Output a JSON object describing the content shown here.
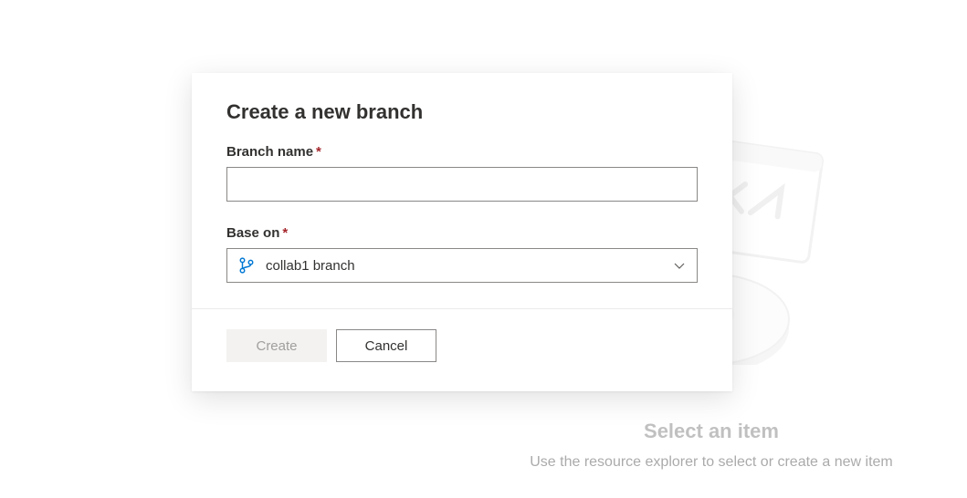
{
  "modal": {
    "title": "Create a new branch",
    "branch_name": {
      "label": "Branch name",
      "value": "",
      "required_marker": "*"
    },
    "base_on": {
      "label": "Base on",
      "required_marker": "*",
      "selected": "collab1 branch"
    },
    "buttons": {
      "create": "Create",
      "cancel": "Cancel"
    }
  },
  "backdrop": {
    "title": "Select an item",
    "subtitle": "Use the resource explorer to select or create a new item"
  }
}
